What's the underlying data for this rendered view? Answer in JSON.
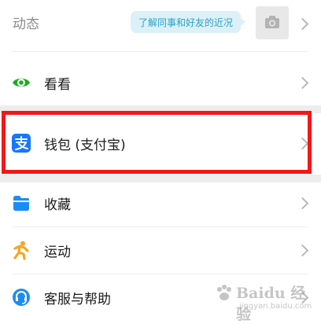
{
  "moments": {
    "title": "动态",
    "bubble_text": "了解同事和好友的近况",
    "camera_icon": "camera-icon"
  },
  "menu": [
    {
      "label": "看看",
      "icon": "eye-icon",
      "color": "#1aad19"
    },
    {
      "label": "钱包 (支付宝)",
      "icon": "alipay-icon",
      "color": "#1677ff"
    },
    {
      "label": "收藏",
      "icon": "folder-icon",
      "color": "#1a8cf5"
    },
    {
      "label": "运动",
      "icon": "running-icon",
      "color": "#f5a623"
    },
    {
      "label": "客服与帮助",
      "icon": "headset-icon",
      "color": "#1a8cf5"
    }
  ],
  "highlight_color": "#f01818",
  "watermark": {
    "brand": "Baidu 经验",
    "url": "jingyan.baidu.com"
  }
}
